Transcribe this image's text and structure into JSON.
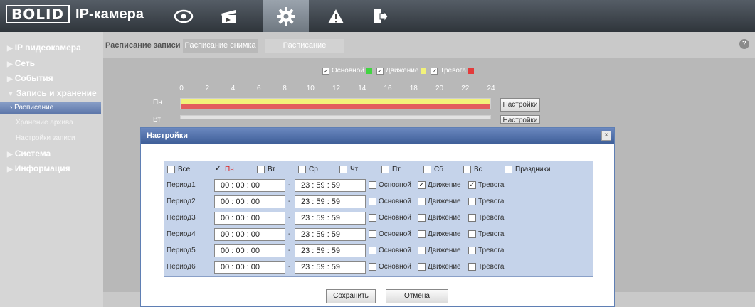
{
  "brand": {
    "logo": "BOLID",
    "title": "IP-камера"
  },
  "nav_icons": [
    "eye-icon",
    "clapper-icon",
    "gear-icon",
    "warning-icon",
    "logout-icon"
  ],
  "sidebar": {
    "items": [
      {
        "label": "IP видеокамера"
      },
      {
        "label": "Сеть"
      },
      {
        "label": "События"
      },
      {
        "label": "Запись и хранение",
        "expanded": true,
        "children": [
          {
            "label": "Расписание",
            "active": true
          },
          {
            "label": "Хранение архива"
          },
          {
            "label": "Настройки записи"
          }
        ]
      },
      {
        "label": "Система"
      },
      {
        "label": "Информация"
      }
    ]
  },
  "tabs": [
    {
      "label": "Расписание записи",
      "active": true
    },
    {
      "label": "Расписание снимка"
    },
    {
      "label": "Расписание"
    }
  ],
  "help": "?",
  "legend": [
    {
      "label": "Основной",
      "color": "#41d441",
      "checked": true
    },
    {
      "label": "Движение",
      "color": "#f2f27a",
      "checked": true
    },
    {
      "label": "Тревога",
      "color": "#e33b3b",
      "checked": true
    }
  ],
  "hours": [
    "0",
    "2",
    "4",
    "6",
    "8",
    "10",
    "12",
    "14",
    "16",
    "18",
    "20",
    "22",
    "24"
  ],
  "days": [
    "Пн",
    "Вт"
  ],
  "settings_button": "Настройки",
  "dialog": {
    "title": "Настройки",
    "close": "×",
    "days": [
      {
        "label": "Все",
        "checked": false
      },
      {
        "label": "Пн",
        "checked": true
      },
      {
        "label": "Вт",
        "checked": false
      },
      {
        "label": "Ср",
        "checked": false
      },
      {
        "label": "Чт",
        "checked": false
      },
      {
        "label": "Пт",
        "checked": false
      },
      {
        "label": "Сб",
        "checked": false
      },
      {
        "label": "Вс",
        "checked": false
      },
      {
        "label": "Праздники",
        "checked": false
      }
    ],
    "periods": [
      {
        "label": "Период1",
        "start": [
          "00",
          "00",
          "00"
        ],
        "end": [
          "23",
          "59",
          "59"
        ],
        "main": false,
        "motion": true,
        "alarm": true
      },
      {
        "label": "Период2",
        "start": [
          "00",
          "00",
          "00"
        ],
        "end": [
          "23",
          "59",
          "59"
        ],
        "main": false,
        "motion": false,
        "alarm": false
      },
      {
        "label": "Период3",
        "start": [
          "00",
          "00",
          "00"
        ],
        "end": [
          "23",
          "59",
          "59"
        ],
        "main": false,
        "motion": false,
        "alarm": false
      },
      {
        "label": "Период4",
        "start": [
          "00",
          "00",
          "00"
        ],
        "end": [
          "23",
          "59",
          "59"
        ],
        "main": false,
        "motion": false,
        "alarm": false
      },
      {
        "label": "Период5",
        "start": [
          "00",
          "00",
          "00"
        ],
        "end": [
          "23",
          "59",
          "59"
        ],
        "main": false,
        "motion": false,
        "alarm": false
      },
      {
        "label": "Период6",
        "start": [
          "00",
          "00",
          "00"
        ],
        "end": [
          "23",
          "59",
          "59"
        ],
        "main": false,
        "motion": false,
        "alarm": false
      }
    ],
    "type_labels": {
      "main": "Основной",
      "motion": "Движение",
      "alarm": "Тревога"
    },
    "time_sep": ":",
    "range_sep": "-",
    "save": "Сохранить",
    "cancel": "Отмена"
  }
}
